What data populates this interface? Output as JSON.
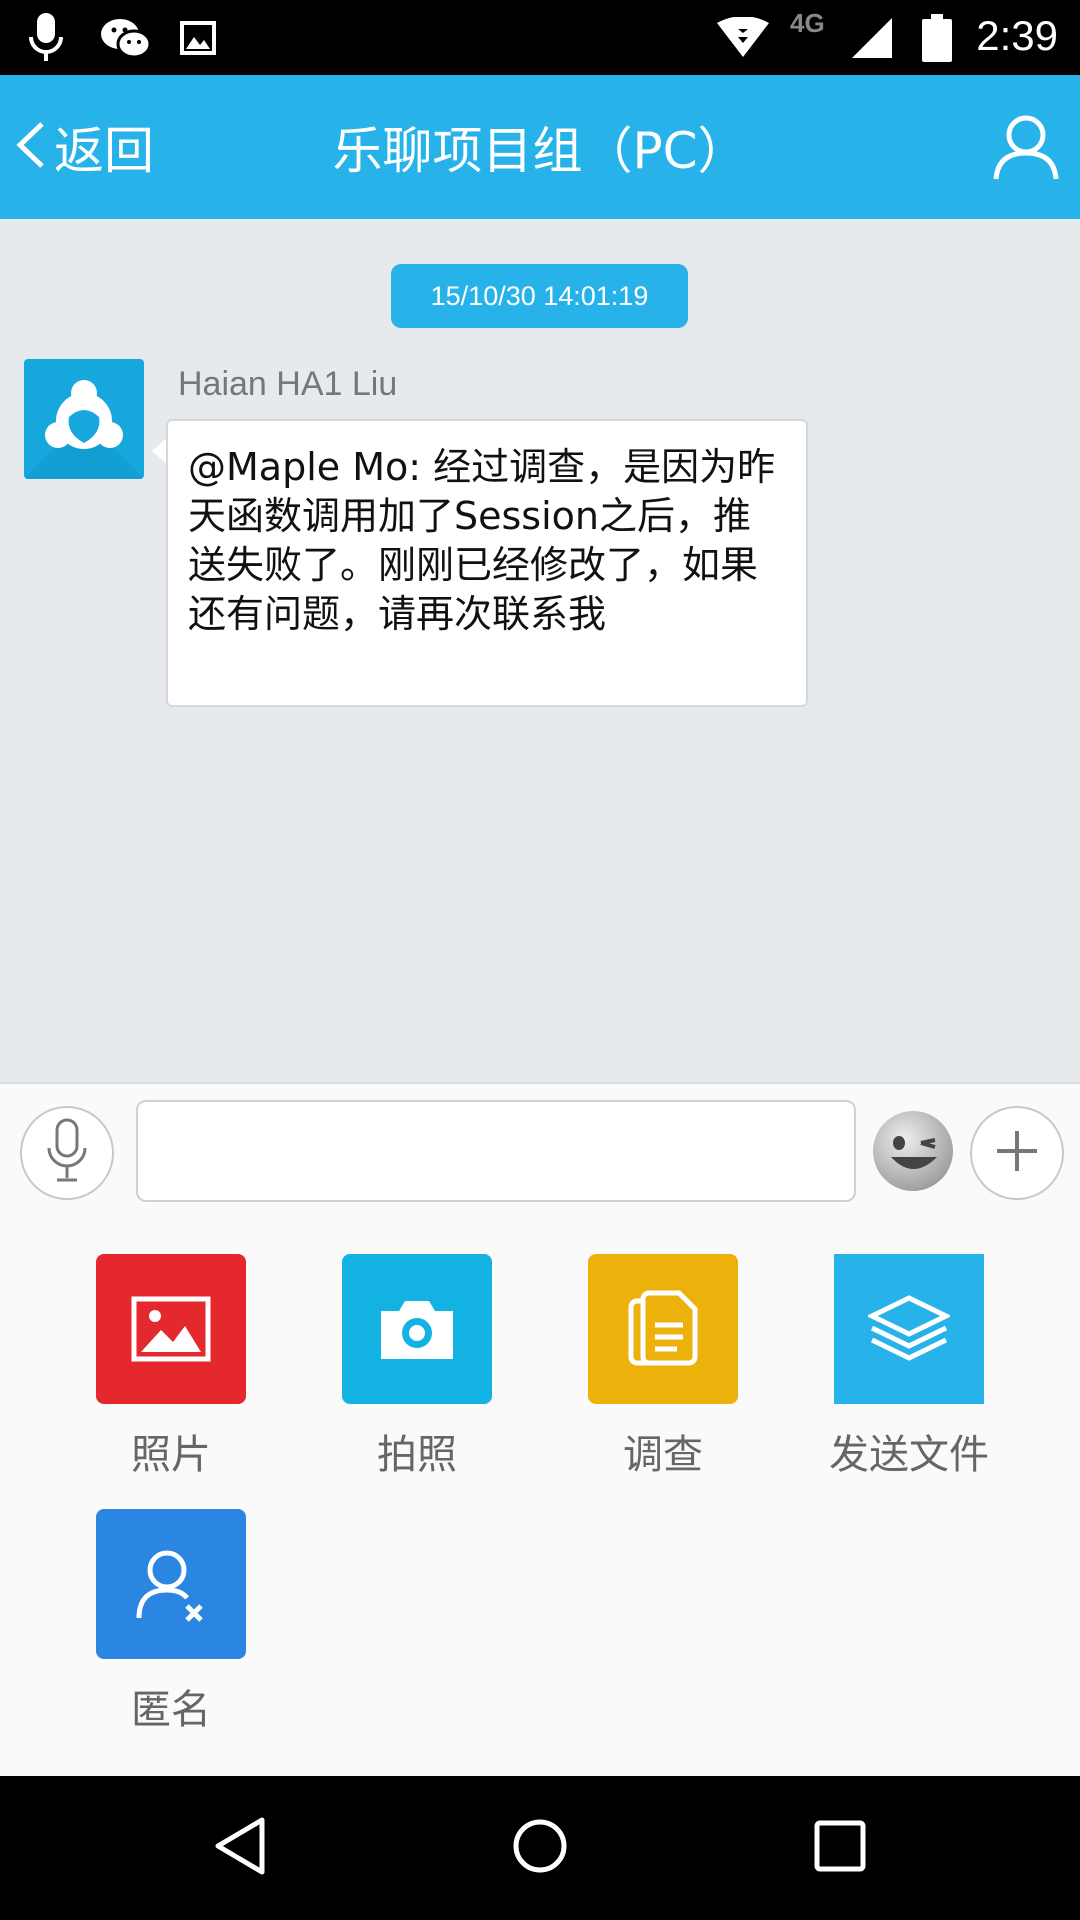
{
  "status_bar": {
    "time": "2:39",
    "network": "4G",
    "icons": [
      "mic-icon",
      "wechat-icon",
      "image-icon",
      "wifi-icon",
      "signal-icon",
      "battery-icon"
    ]
  },
  "header": {
    "back_label": "返回",
    "title": "乐聊项目组（PC）",
    "background": "#27b3ea"
  },
  "chat": {
    "timestamp": "15/10/30 14:01:19",
    "messages": [
      {
        "sender": "Haian HA1 Liu",
        "text": "@Maple Mo: 经过调查，是因为昨天函数调用加了Session之后，推送失败了。刚刚已经修改了，如果还有问题，请再次联系我"
      }
    ]
  },
  "input": {
    "value": "",
    "placeholder": ""
  },
  "panel": {
    "items": [
      {
        "label": "照片",
        "icon": "photo-icon",
        "color": "#e5282d"
      },
      {
        "label": "拍照",
        "icon": "camera-icon",
        "color": "#12b3e2"
      },
      {
        "label": "调查",
        "icon": "survey-icon",
        "color": "#edb10c"
      },
      {
        "label": "发送文件",
        "icon": "file-stack-icon",
        "color": "#27b3ea"
      },
      {
        "label": "匿名",
        "icon": "anonymous-user-icon",
        "color": "#2a86e0"
      }
    ]
  },
  "nav": {
    "icons": [
      "back-triangle-icon",
      "home-circle-icon",
      "recents-square-icon"
    ]
  }
}
